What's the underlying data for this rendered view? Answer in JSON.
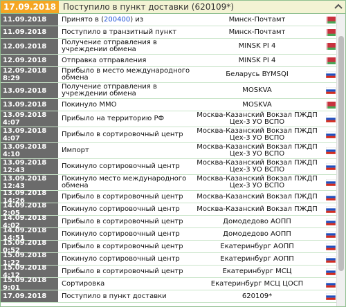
{
  "header": {
    "date": "17.09.2018",
    "title": "Поступило в пункт доставки (620109*)"
  },
  "colors": {
    "header_date_bg": "#f5a623",
    "date_cell_bg": "#6b6b6b"
  },
  "flags": {
    "belarus": "belarus-flag-icon",
    "russia": "russia-flag-icon"
  },
  "events": [
    {
      "date": "11.09.2018",
      "event": "Принято в (200400) из",
      "event_pre": "Принято в (",
      "event_link": "200400",
      "event_post": ") из",
      "location": "Минск-Почтамт",
      "flag": "by",
      "h": 1
    },
    {
      "date": "11.09.2018",
      "event": "Поступило в транзитный пункт",
      "location": "Минск-Почтамт",
      "flag": "by",
      "h": 1
    },
    {
      "date": "12.09.2018",
      "event": "Получение отправления в учреждении обмена",
      "location": "MINSK PI 4",
      "flag": "by",
      "h": 2
    },
    {
      "date": "12.09.2018",
      "event": "Отправка отправления",
      "location": "MINSK PI 4",
      "flag": "by",
      "h": 1
    },
    {
      "date": "12.09.2018 8:29",
      "event": "Прибыло в место международного обмена",
      "location": "Беларусь BYMSQI",
      "flag": "ru",
      "h": 2
    },
    {
      "date": "13.09.2018",
      "event": "Получение отправления в учреждении обмена",
      "location": "MOSKVA",
      "flag": "ru",
      "h": 2
    },
    {
      "date": "13.09.2018",
      "event": "Покинуло ММО",
      "location": "MOSKVA",
      "flag": "by",
      "h": 1
    },
    {
      "date": "13.09.2018 4:07",
      "event": "Прибыло на территорию РФ",
      "location": "Москва-Казанский Вокзал ПЖДП Цех-3 УО ВСПО",
      "flag": "ru",
      "h": 2
    },
    {
      "date": "13.09.2018 4:07",
      "event": "Прибыло в сортировочный центр",
      "location": "Москва-Казанский Вокзал ПЖДП Цех-3 УО ВСПО",
      "flag": "ru",
      "h": 2
    },
    {
      "date": "13.09.2018 4:10",
      "event": "Импорт",
      "location": "Москва-Казанский Вокзал ПЖДП Цех-3 УО ВСПО",
      "flag": "ru",
      "h": 2
    },
    {
      "date": "13.09.2018 12:43",
      "event": "Покинуло сортировочный центр",
      "location": "Москва-Казанский Вокзал ПЖДП Цех-3 УО ВСПО",
      "flag": "ru",
      "h": 2
    },
    {
      "date": "13.09.2018 12:43",
      "event": "Покинуло место международного обмена",
      "location": "Москва-Казанский Вокзал ПЖДП Цех-3 УО ВСПО",
      "flag": "ru",
      "h": 2
    },
    {
      "date": "13.09.2018 14:26",
      "event": "Прибыло в сортировочный центр",
      "location": "Москва-Казанский Вокзал ПЖДП",
      "flag": "ru",
      "h": 1
    },
    {
      "date": "14.09.2018 2:05",
      "event": "Покинуло сортировочный центр",
      "location": "Москва-Казанский Вокзал ПЖДП",
      "flag": "ru",
      "h": 1
    },
    {
      "date": "14.09.2018 4:02",
      "event": "Прибыло в сортировочный центр",
      "location": "Домодедово АОПП",
      "flag": "ru",
      "h": 1
    },
    {
      "date": "14.09.2018 14:51",
      "event": "Покинуло сортировочный центр",
      "location": "Домодедово АОПП",
      "flag": "ru",
      "h": 1
    },
    {
      "date": "15.09.2018 0:52",
      "event": "Прибыло в сортировочный центр",
      "location": "Екатеринбург АОПП",
      "flag": "ru",
      "h": 1
    },
    {
      "date": "15.09.2018 1:22",
      "event": "Покинуло сортировочный центр",
      "location": "Екатеринбург АОПП",
      "flag": "ru",
      "h": 1
    },
    {
      "date": "15.09.2018 4:12",
      "event": "Прибыло в сортировочный центр",
      "location": "Екатеринбург МСЦ",
      "flag": "ru",
      "h": 1
    },
    {
      "date": "15.09.2018 9:01",
      "event": "Сортировка",
      "location": "Екатеринбург МСЦ ЦОСП",
      "flag": "ru",
      "h": 1
    },
    {
      "date": "17.09.2018",
      "event": "Поступило в пункт доставки",
      "location": "620109*",
      "flag": "ru",
      "h": 1
    }
  ]
}
